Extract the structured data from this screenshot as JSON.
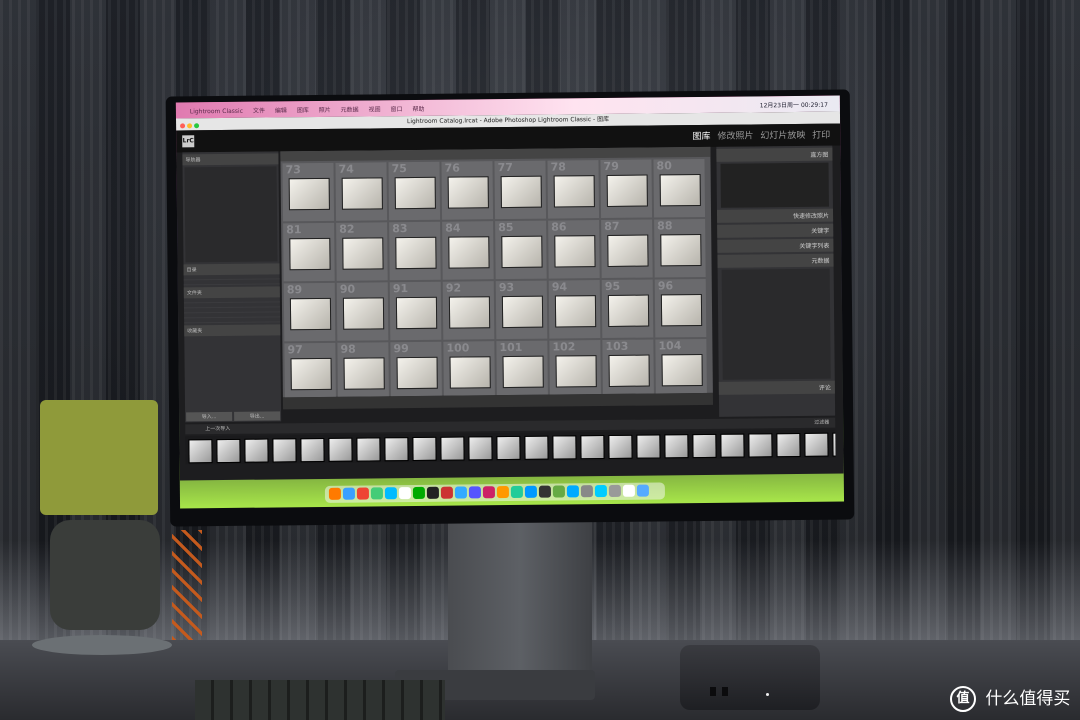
{
  "menubar": {
    "app_name": "Lightroom Classic",
    "items": [
      "文件",
      "编辑",
      "图库",
      "照片",
      "元数据",
      "视图",
      "窗口",
      "帮助"
    ],
    "clock": "12月23日周一 00:29:17"
  },
  "window": {
    "title": "Lightroom Catalog.lrcat - Adobe Photoshop Lightroom Classic - 图库"
  },
  "identity_plate": {
    "logo": "LrC"
  },
  "modules": {
    "library": "图库",
    "develop": "修改照片",
    "slideshow": "幻灯片放映",
    "print": "打印"
  },
  "left_panel": {
    "navigator": "导航器",
    "catalog": "目录",
    "folders": "文件夹",
    "collections": "收藏夹",
    "import_button": "导入...",
    "export_button": "导出..."
  },
  "grid": {
    "numbers": [
      "73",
      "74",
      "75",
      "76",
      "77",
      "78",
      "79",
      "80",
      "81",
      "82",
      "83",
      "84",
      "85",
      "86",
      "87",
      "88",
      "89",
      "90",
      "91",
      "92",
      "93",
      "94",
      "95",
      "96",
      "97",
      "98",
      "99",
      "100",
      "101",
      "102",
      "103",
      "104"
    ]
  },
  "right_panel": {
    "histogram": "直方图",
    "quick_develop": "快速修改照片",
    "keywording": "关键字",
    "keyword_list": "关键字列表",
    "metadata": "元数据",
    "comments": "评论"
  },
  "filmstrip": {
    "source_label": "上一次导入",
    "filter_label": "过滤器"
  },
  "watermark": {
    "badge": "值",
    "text": "什么值得买"
  },
  "colors": {
    "lightroom_bg": "#1d1d1f",
    "wallpaper_accent": "#a8e64a"
  }
}
